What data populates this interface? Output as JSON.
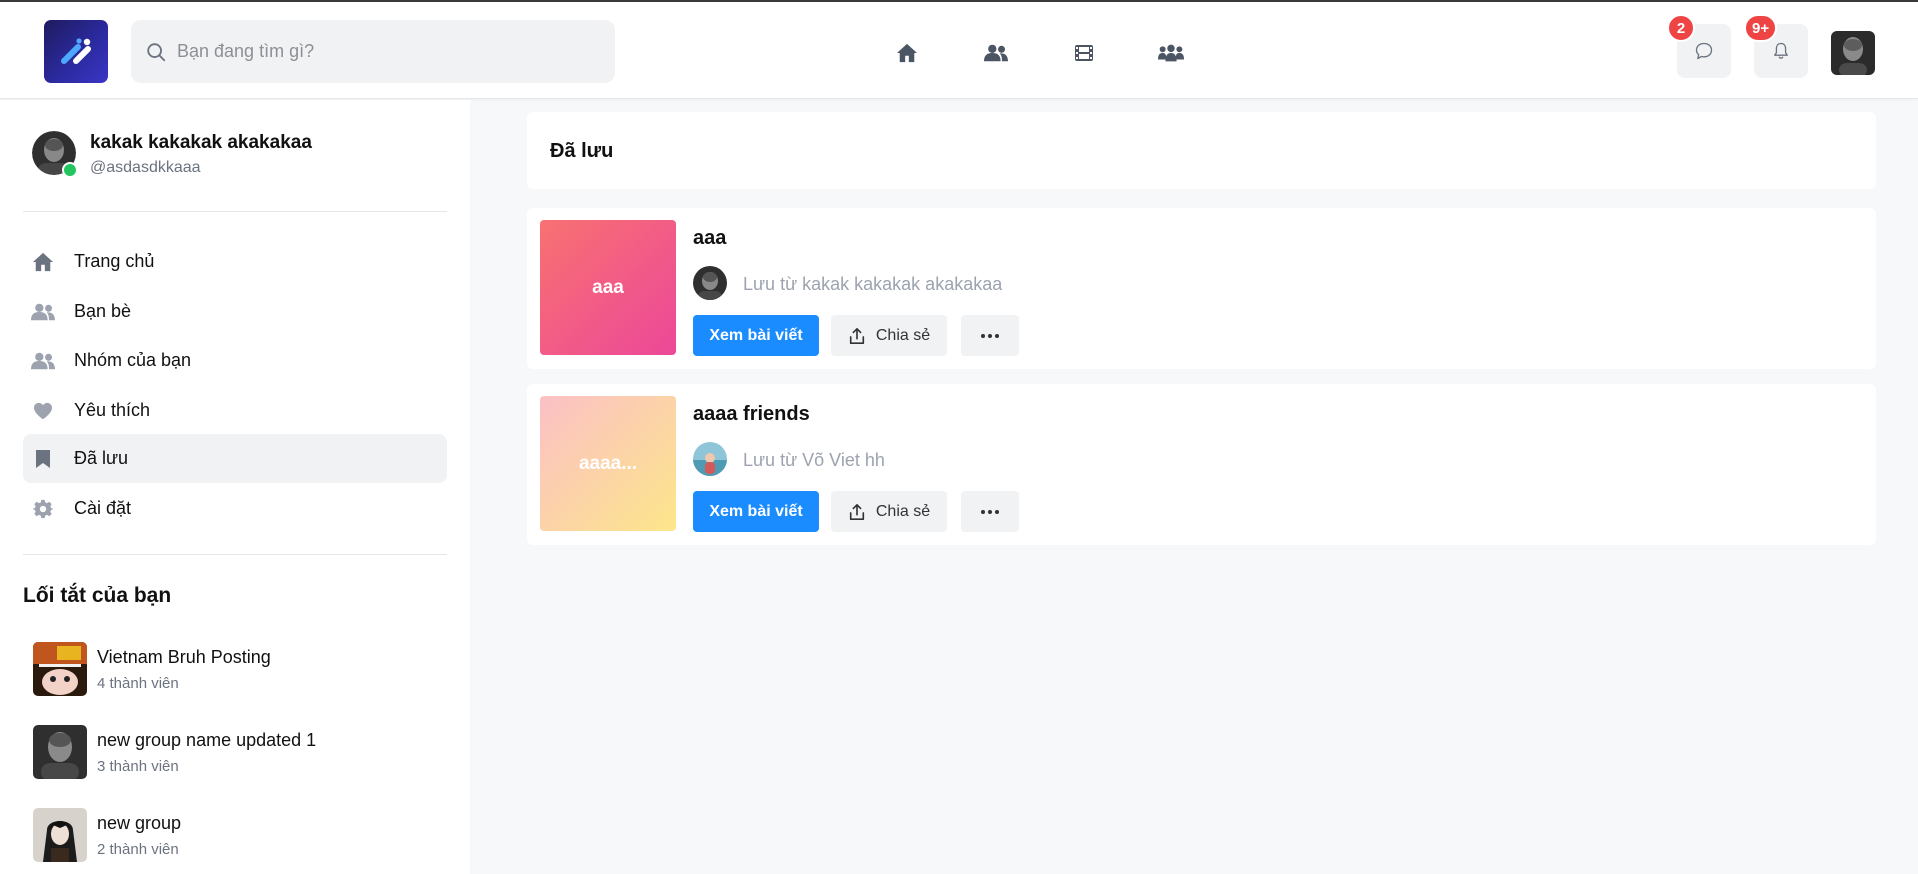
{
  "header": {
    "search_placeholder": "Bạn đang tìm gì?",
    "nav": [
      "home-icon",
      "friends-icon",
      "video-icon",
      "groups-icon"
    ],
    "messages_badge": "2",
    "notifications_badge": "9+"
  },
  "sidebar": {
    "profile": {
      "name": "kakak kakakak akakakaa",
      "handle": "@asdasdkkaaa"
    },
    "menu": [
      {
        "label": "Trang chủ",
        "icon": "home-icon"
      },
      {
        "label": "Bạn bè",
        "icon": "friends-icon"
      },
      {
        "label": "Nhóm của bạn",
        "icon": "groups-icon"
      },
      {
        "label": "Yêu thích",
        "icon": "heart-icon"
      },
      {
        "label": "Đã lưu",
        "icon": "bookmark-icon",
        "active": true
      },
      {
        "label": "Cài đặt",
        "icon": "gear-icon"
      }
    ],
    "shortcuts_title": "Lối tắt của bạn",
    "shortcuts": [
      {
        "name": "Vietnam Bruh Posting",
        "members": "4 thành viên"
      },
      {
        "name": "new group name updated 1",
        "members": "3 thành viên"
      },
      {
        "name": "new group",
        "members": "2 thành viên"
      }
    ]
  },
  "main": {
    "title": "Đã lưu",
    "saved_items": [
      {
        "thumb_text": "aaa",
        "title": "aaa",
        "saved_from": "Lưu từ kakak kakakak akakakaa",
        "view_label": "Xem bài viết",
        "share_label": "Chia sẻ"
      },
      {
        "thumb_text": "aaaa...",
        "title": "aaaa friends",
        "saved_from": "Lưu từ Võ Viet hh",
        "view_label": "Xem bài viết",
        "share_label": "Chia sẻ"
      }
    ]
  },
  "colors": {
    "accent": "#1a8cff",
    "badge": "#ef4444",
    "online": "#22c55e"
  }
}
